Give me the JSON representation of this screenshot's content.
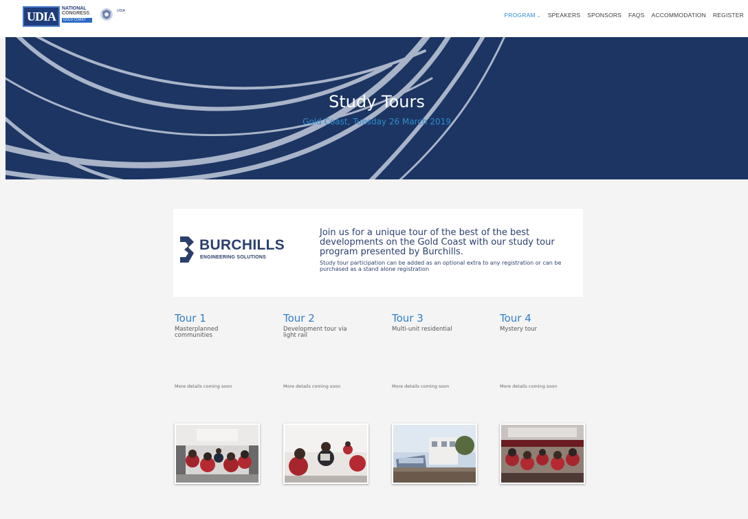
{
  "brand": {
    "logo_text": "UDIA",
    "natcong_line1": "NATIONAL",
    "natcong_line2": "CONGRESS",
    "natcong_line3": "GOLD COAST",
    "small_logo_text": "UDIA"
  },
  "nav": {
    "items": [
      {
        "label": "PROGRAM",
        "active": true,
        "has_dropdown": true
      },
      {
        "label": "SPEAKERS"
      },
      {
        "label": "SPONSORS"
      },
      {
        "label": "FAQS"
      },
      {
        "label": "ACCOMMODATION"
      },
      {
        "label": "REGISTER"
      }
    ]
  },
  "hero": {
    "title": "Study Tours",
    "subtitle": "Gold Coast, Tuesday 26 March 2019",
    "bg_color": "#1c3563",
    "accent_color": "#2f8ccf"
  },
  "sponsor": {
    "name": "BURCHILLS",
    "tagline": "ENGINEERING SOLUTIONS",
    "heading": "Join us for a unique tour of the best of the best developments on the Gold Coast with our study tour program presented by Burchills.",
    "body": "Study tour participation can be added as an optional extra to any registration or can be purchased as a stand alone registration"
  },
  "tours": [
    {
      "title": "Tour 1",
      "desc": "Masterplanned communities",
      "more": "More details coming soon"
    },
    {
      "title": "Tour 2",
      "desc": "Development tour via light rail",
      "more": "More details coming soon"
    },
    {
      "title": "Tour 3",
      "desc": "Multi-unit residential",
      "more": "More details coming soon"
    },
    {
      "title": "Tour 4",
      "desc": "Mystery tour",
      "more": "More details coming soon"
    }
  ],
  "icons": {
    "chevron": "chevron-down-icon",
    "seal": "crest-icon"
  }
}
